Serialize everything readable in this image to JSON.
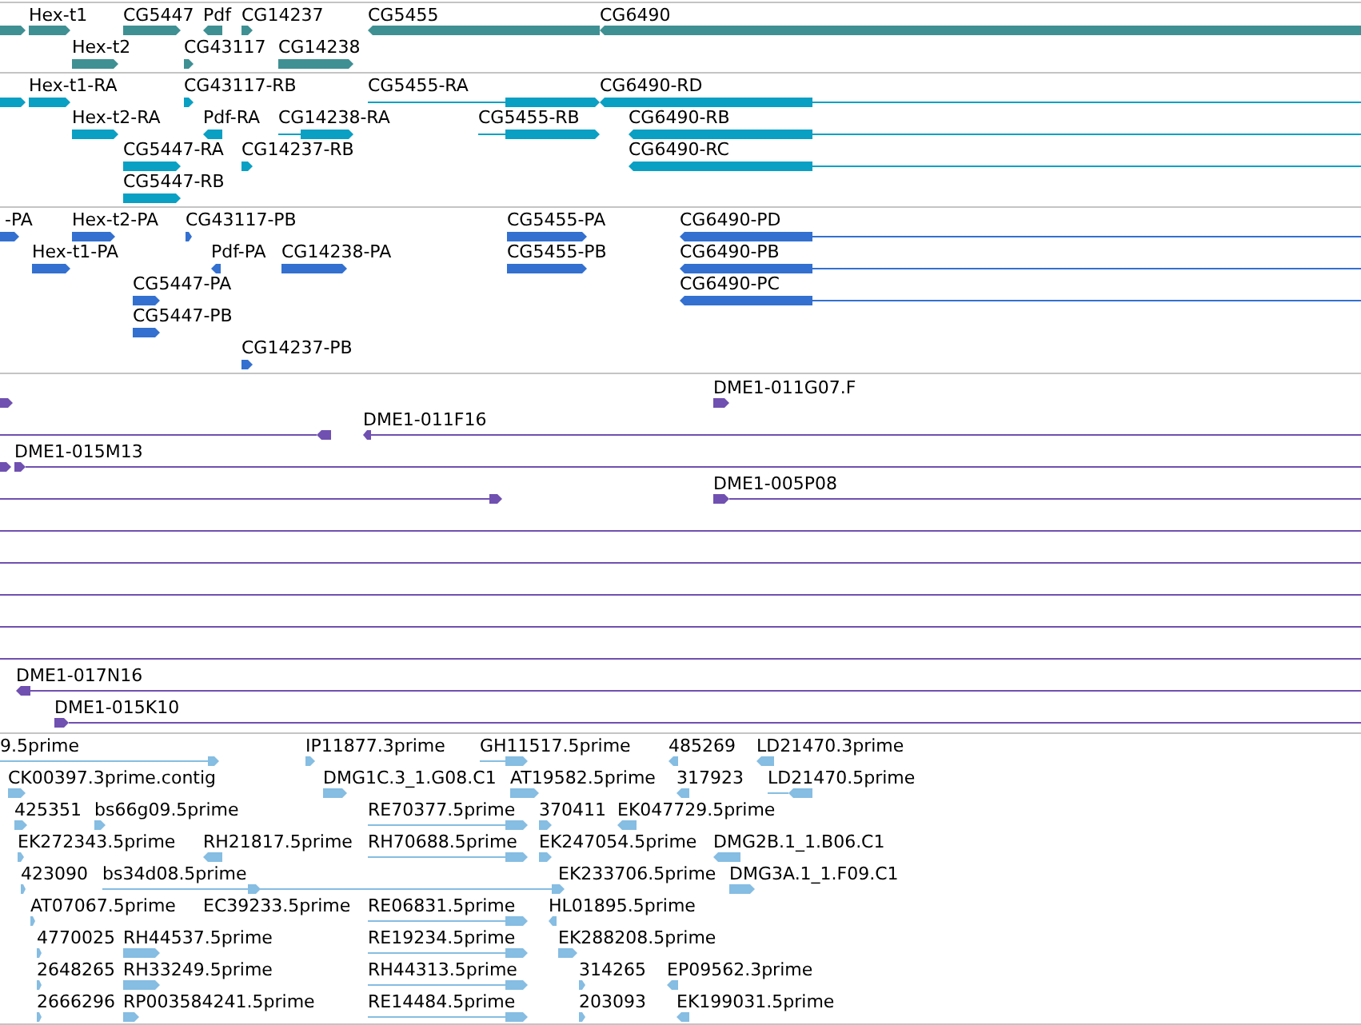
{
  "tracks": [
    {
      "color": "#3f9093",
      "rows": [
        {
          "features": [
            {
              "reverse": false
            },
            {
              "label": "Hex-t1",
              "reverse": false
            },
            {
              "label": "CG5447",
              "reverse": false
            },
            {
              "label": "Pdf",
              "reverse": true
            },
            {
              "label": "CG14237",
              "reverse": false
            },
            {
              "label": "CG5455",
              "reverse": true
            },
            {
              "label": "CG6490",
              "reverse": true
            }
          ]
        },
        {
          "features": [
            {
              "label": "Hex-t2",
              "reverse": false
            },
            {
              "label": "CG43117",
              "reverse": false
            },
            {
              "label": "CG14238",
              "reverse": false
            }
          ]
        }
      ]
    },
    {
      "color": "#0aa0c4",
      "rows": [
        {
          "features": [
            {
              "reverse": false
            },
            {
              "label": "Hex-t1-RA",
              "reverse": false
            },
            {
              "label": "CG43117-RB",
              "reverse": false
            },
            {
              "label": "CG5455-RA",
              "reverse": false
            },
            {
              "label": "CG6490-RD",
              "reverse": true
            }
          ]
        },
        {
          "features": [
            {
              "label": "Hex-t2-RA",
              "reverse": false
            },
            {
              "label": "Pdf-RA",
              "reverse": true
            },
            {
              "label": "CG14238-RA",
              "reverse": false
            },
            {
              "label": "CG5455-RB",
              "reverse": false
            },
            {
              "label": "CG6490-RB",
              "reverse": true
            }
          ]
        },
        {
          "features": [
            {
              "label": "CG5447-RA",
              "reverse": false
            },
            {
              "label": "CG14237-RB",
              "reverse": false
            },
            {
              "label": "CG6490-RC",
              "reverse": true
            }
          ]
        },
        {
          "features": [
            {
              "label": "CG5447-RB",
              "reverse": false
            }
          ]
        }
      ]
    },
    {
      "color": "#3370d0",
      "rows": [
        {
          "features": [
            {
              "label": "-PA",
              "reverse": false
            },
            {
              "label": "Hex-t2-PA",
              "reverse": false
            },
            {
              "label": "CG43117-PB",
              "reverse": false
            },
            {
              "label": "CG5455-PA",
              "reverse": false
            },
            {
              "label": "CG6490-PD",
              "reverse": true
            }
          ]
        },
        {
          "features": [
            {
              "label": "Hex-t1-PA",
              "reverse": false
            },
            {
              "label": "Pdf-PA",
              "reverse": true
            },
            {
              "label": "CG14238-PA",
              "reverse": false
            },
            {
              "label": "CG5455-PB",
              "reverse": false
            },
            {
              "label": "CG6490-PB",
              "reverse": true
            }
          ]
        },
        {
          "features": [
            {
              "label": "CG5447-PA",
              "reverse": false
            },
            {
              "label": "CG6490-PC",
              "reverse": true
            }
          ]
        },
        {
          "features": [
            {
              "label": "CG5447-PB",
              "reverse": false
            }
          ]
        },
        {
          "features": [
            {
              "label": "CG14237-PB",
              "reverse": false
            }
          ]
        }
      ]
    },
    {
      "color": "#7050b0",
      "rows": [
        {
          "features": [
            {
              "reverse": false
            },
            {
              "label": "DME1-011G07.F",
              "reverse": false
            }
          ]
        },
        {
          "features": [
            {
              "reverse": true
            },
            {
              "label": "DME1-011F16",
              "reverse": true
            }
          ]
        },
        {
          "features": [
            {
              "reverse": false
            },
            {
              "label": "DME1-015M13",
              "reverse": false
            }
          ]
        },
        {
          "features": [
            {
              "reverse": false
            },
            {
              "label": "DME1-005P08",
              "reverse": false
            }
          ]
        },
        {
          "features": [
            {
              "kind": "span"
            }
          ]
        },
        {
          "features": [
            {
              "kind": "span"
            }
          ]
        },
        {
          "features": [
            {
              "kind": "span"
            }
          ]
        },
        {
          "features": [
            {
              "kind": "span"
            }
          ]
        },
        {
          "features": [
            {
              "kind": "span"
            }
          ]
        },
        {
          "features": [
            {
              "label": "DME1-017N16",
              "reverse": true
            }
          ]
        },
        {
          "features": [
            {
              "label": "DME1-015K10",
              "reverse": false
            }
          ]
        }
      ]
    },
    {
      "color": "#86bde2",
      "rows": [
        {
          "features": [
            {
              "label": "9.5prime",
              "reverse": false
            },
            {
              "label": "IP11877.3prime",
              "reverse": false
            },
            {
              "label": "GH11517.5prime",
              "reverse": false
            },
            {
              "label": "485269",
              "reverse": true
            },
            {
              "label": "LD21470.3prime",
              "reverse": true
            }
          ]
        },
        {
          "features": [
            {
              "label": "CK00397.3prime.contig",
              "reverse": false
            },
            {
              "label": "DMG1C.3_1.G08.C1",
              "reverse": false
            },
            {
              "label": "AT19582.5prime",
              "reverse": false
            },
            {
              "label": "317923",
              "reverse": true
            },
            {
              "label": "LD21470.5prime",
              "reverse": true
            }
          ]
        },
        {
          "features": [
            {
              "label": "425351",
              "reverse": false
            },
            {
              "label": "bs66g09.5prime",
              "reverse": false
            },
            {
              "label": "RE70377.5prime",
              "reverse": false
            },
            {
              "label": "370411",
              "reverse": false
            },
            {
              "label": "EK047729.5prime",
              "reverse": true
            }
          ]
        },
        {
          "features": [
            {
              "label": "EK272343.5prime",
              "reverse": false
            },
            {
              "label": "RH21817.5prime",
              "reverse": true
            },
            {
              "label": "RH70688.5prime",
              "reverse": false
            },
            {
              "label": "EK247054.5prime",
              "reverse": false
            },
            {
              "label": "DMG2B.1_1.B06.C1",
              "reverse": true
            }
          ]
        },
        {
          "features": [
            {
              "label": "423090",
              "reverse": false
            },
            {
              "label": "bs34d08.5prime",
              "reverse": false
            },
            {
              "label": "EK233706.5prime",
              "reverse": false
            },
            {
              "label": "DMG3A.1_1.F09.C1",
              "reverse": false
            }
          ]
        },
        {
          "features": [
            {
              "label": "AT07067.5prime",
              "reverse": false
            },
            {
              "label": "EC39233.5prime"
            },
            {
              "label": "RE06831.5prime",
              "reverse": false
            },
            {
              "label": "HL01895.5prime",
              "reverse": true
            }
          ]
        },
        {
          "features": [
            {
              "label": "4770025",
              "reverse": false
            },
            {
              "label": "RH44537.5prime",
              "reverse": false
            },
            {
              "label": "RE19234.5prime",
              "reverse": false
            },
            {
              "label": "EK288208.5prime",
              "reverse": false
            }
          ]
        },
        {
          "features": [
            {
              "label": "2648265",
              "reverse": false
            },
            {
              "label": "RH33249.5prime",
              "reverse": false
            },
            {
              "label": "RH44313.5prime",
              "reverse": false
            },
            {
              "label": "314265",
              "reverse": false
            },
            {
              "label": "EP09562.3prime",
              "reverse": true
            }
          ]
        },
        {
          "features": [
            {
              "label": "2666296",
              "reverse": false
            },
            {
              "label": "RP003584241.5prime",
              "reverse": false
            },
            {
              "label": "RE14484.5prime",
              "reverse": false
            },
            {
              "label": "203093",
              "reverse": false
            },
            {
              "label": "EK199031.5prime",
              "reverse": true
            }
          ]
        }
      ]
    }
  ]
}
